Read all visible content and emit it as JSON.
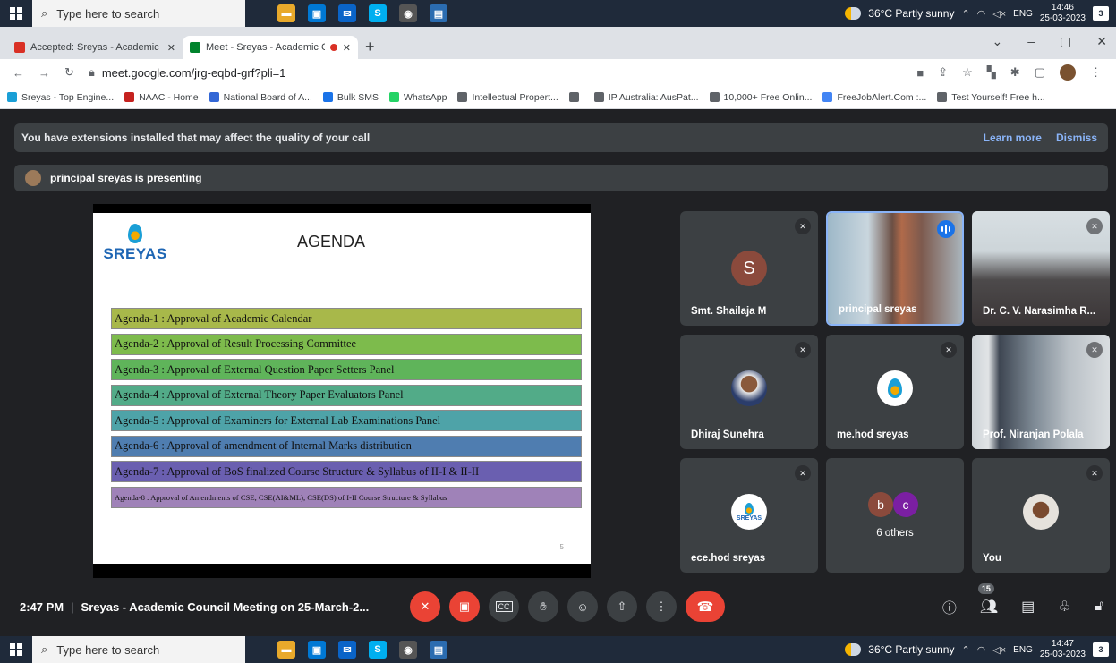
{
  "taskbar": {
    "search_placeholder": "Type here to search",
    "weather": "36°C  Partly sunny",
    "lang": "ENG",
    "top_time": "14:46",
    "bottom_time": "14:47",
    "date": "25-03-2023",
    "notif_count": "3"
  },
  "browser": {
    "tabs": [
      {
        "title": "Accepted: Sreyas - Academic Cou",
        "color": "#d93025",
        "active": false
      },
      {
        "title": "Meet - Sreyas - Academic Co",
        "color": "#00832d",
        "active": true
      }
    ],
    "url": "meet.google.com/jrg-eqbd-grf?pli=1",
    "bookmarks": [
      {
        "label": "Sreyas - Top Engine...",
        "color": "#1a9fd6"
      },
      {
        "label": "NAAC - Home",
        "color": "#c5221f"
      },
      {
        "label": "National Board of A...",
        "color": "#3367d6"
      },
      {
        "label": "Bulk SMS",
        "color": "#1a73e8"
      },
      {
        "label": "WhatsApp",
        "color": "#25d366"
      },
      {
        "label": "Intellectual Propert...",
        "color": "#5f6368"
      },
      {
        "label": "",
        "color": "#5f6368"
      },
      {
        "label": "IP Australia: AusPat...",
        "color": "#5f6368"
      },
      {
        "label": "10,000+ Free Onlin...",
        "color": "#5f6368"
      },
      {
        "label": "FreeJobAlert.Com :...",
        "color": "#4285f4"
      },
      {
        "label": "Test Yourself! Free h...",
        "color": "#5f6368"
      }
    ]
  },
  "meet": {
    "ext_warning": "You have extensions installed that may affect the quality of your call",
    "learn_more": "Learn more",
    "dismiss": "Dismiss",
    "presenting": "principal sreyas is presenting",
    "slide": {
      "logo": "SREYAS",
      "title": "AGENDA",
      "page": "5",
      "items": [
        {
          "text": "Agenda-1 : Approval of Academic Calendar",
          "color": "#a8b84a"
        },
        {
          "text": "Agenda-2 : Approval of Result Processing Committee",
          "color": "#7dbb4c"
        },
        {
          "text": "Agenda-3 : Approval of External Question Paper Setters Panel",
          "color": "#5fb45a"
        },
        {
          "text": "Agenda-4 : Approval of External Theory Paper Evaluators Panel",
          "color": "#52ab88"
        },
        {
          "text": "Agenda-5 : Approval of Examiners for External Lab Examinations Panel",
          "color": "#4ea3a8"
        },
        {
          "text": "Agenda-6 : Approval of amendment of Internal Marks distribution",
          "color": "#4f7db0"
        },
        {
          "text": "Agenda-7 : Approval of BoS finalized Course Structure & Syllabus of II-I & II-II",
          "color": "#6a5fb0"
        },
        {
          "text": "Agenda-8 : Approval of Amendments of CSE, CSE(AI&ML), CSE(DS) of I-II Course Structure & Syllabus",
          "color": "#9f82b8"
        }
      ]
    },
    "participants": [
      {
        "name": "Smt. Shailaja M",
        "letter": "S"
      },
      {
        "name": "principal sreyas"
      },
      {
        "name": "Dr. C. V. Narasimha R..."
      },
      {
        "name": "Dhiraj Sunehra"
      },
      {
        "name": "me.hod sreyas"
      },
      {
        "name": "Prof. Niranjan Polala"
      },
      {
        "name": "ece.hod sreyas"
      },
      {
        "name": "6 others",
        "letters": [
          "b",
          "c"
        ]
      },
      {
        "name": "You"
      }
    ],
    "time": "2:47 PM",
    "meeting_title": "Sreyas - Academic Council Meeting on 25-March-2...",
    "people_count": "15"
  }
}
